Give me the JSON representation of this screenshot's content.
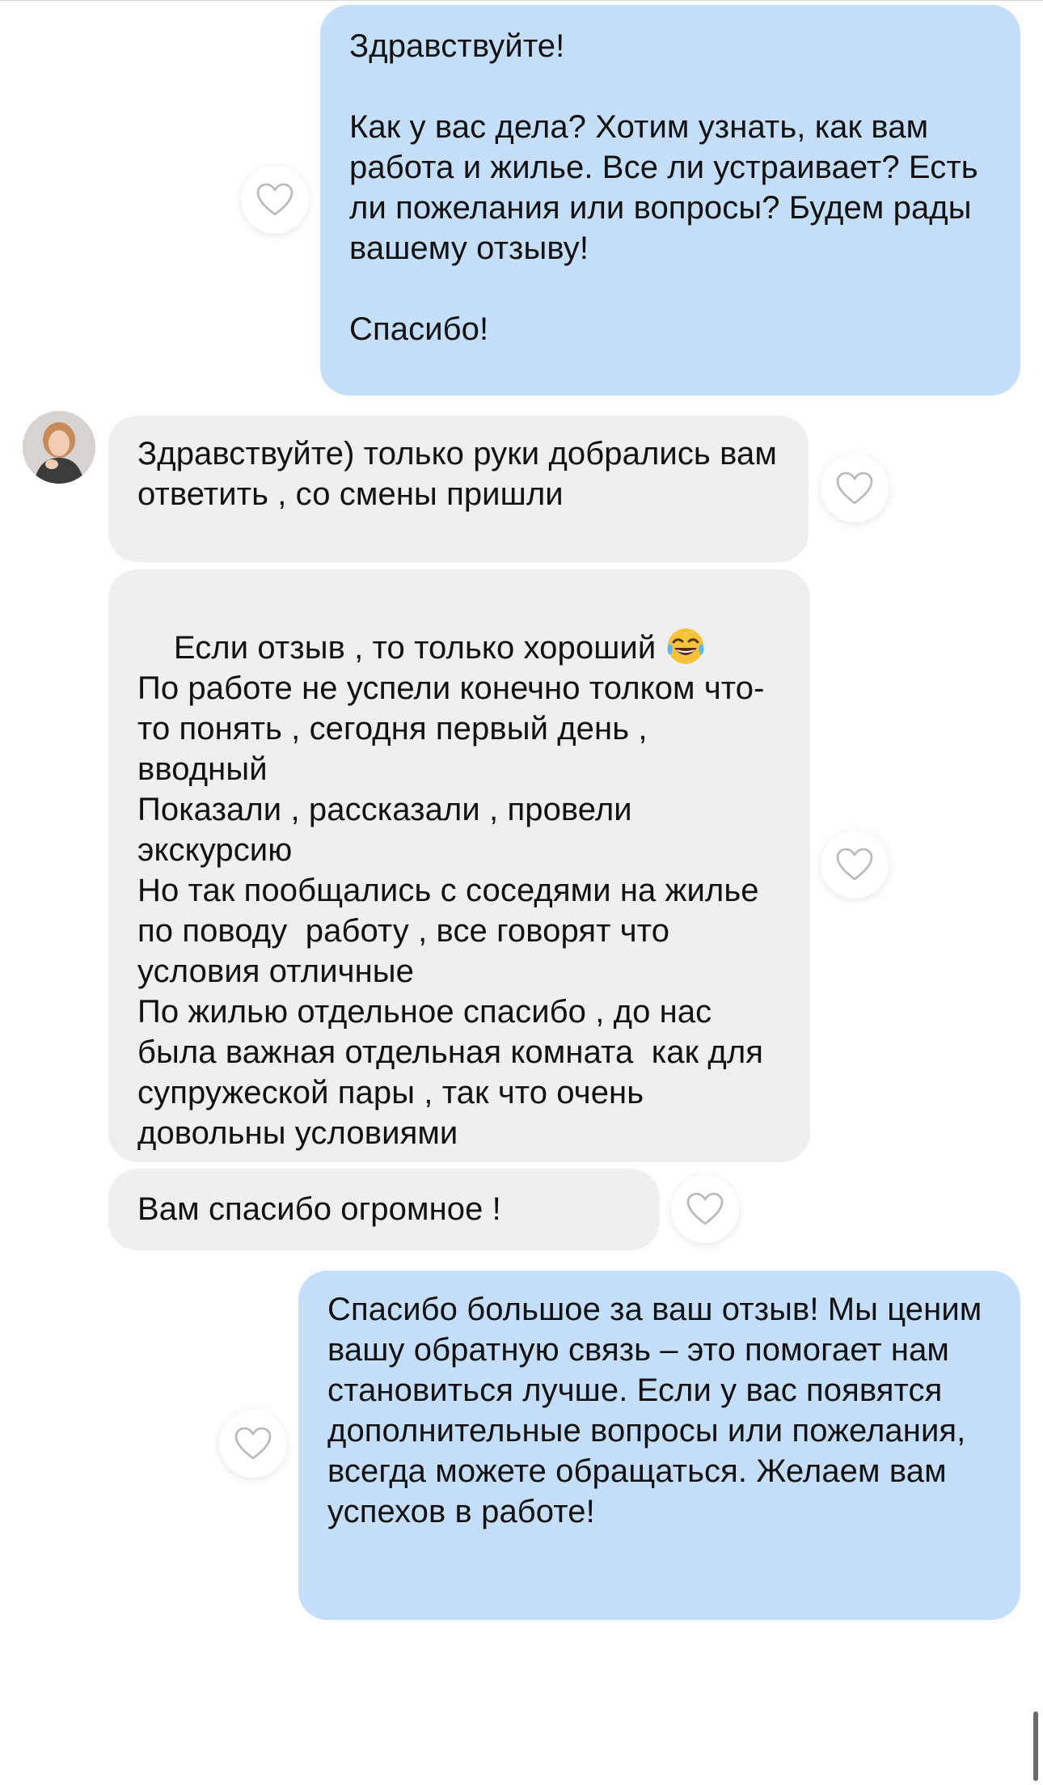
{
  "messages": [
    {
      "id": "m1",
      "direction": "outgoing",
      "text": "Здравствуйте!\n\nКак у вас дела? Хотим узнать, как вам работа и жилье. Все ли устраивает? Есть ли пожелания или вопросы? Будем рады вашему отзыву!\n\nСпасибо!"
    },
    {
      "id": "m2",
      "direction": "incoming",
      "text": "Здравствуйте) только руки добрались вам ответить , со смены пришли"
    },
    {
      "id": "m3",
      "direction": "incoming",
      "text_first_line": "Если отзыв , то только хороший",
      "emoji": "face-with-tears-of-joy",
      "text_rest": "По работе не успели конечно толком что-то понять , сегодня первый день , вводный\nПоказали , рассказали , провели экскурсию\nНо так пообщались с соседями на жилье по поводу  работу , все говорят что условия отличные\nПо жилью отдельное спасибо , до нас была важная отдельная комната  как для супружеской пары , так что очень довольны условиями"
    },
    {
      "id": "m4",
      "direction": "incoming",
      "text": "Вам спасибо огромное !"
    },
    {
      "id": "m5",
      "direction": "outgoing",
      "text": "Спасибо большое за ваш отзыв! Мы ценим вашу обратную связь – это помогает нам становиться лучше. Если у вас появятся дополнительные вопросы или пожелания, всегда можете обращаться. Желаем вам успехов в работе!"
    }
  ],
  "icons": {
    "like": "heart-outline-icon",
    "avatar": "user-avatar"
  },
  "colors": {
    "outgoing_bubble": "#c5defb",
    "incoming_bubble": "#efefef",
    "heart_stroke": "#b8b8b8"
  }
}
